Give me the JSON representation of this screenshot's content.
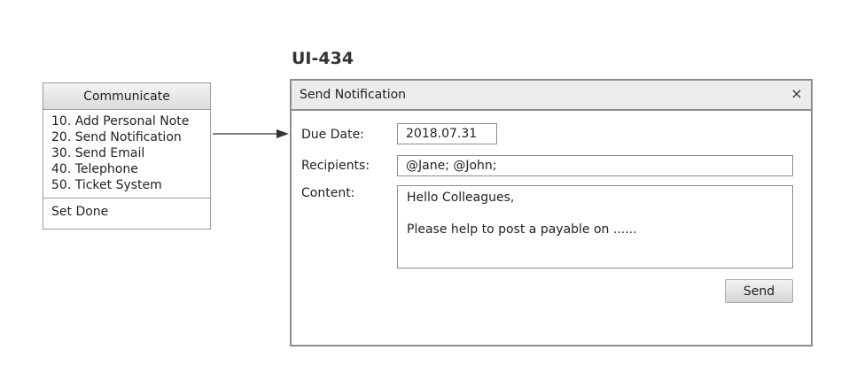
{
  "screen_id": "UI-434",
  "menu": {
    "title": "Communicate",
    "items": [
      "10. Add Personal Note",
      "20. Send Notification",
      "30. Send Email",
      "40. Telephone",
      "50. Ticket System"
    ],
    "footer": "Set Done"
  },
  "dialog": {
    "title": "Send Notification",
    "close_glyph": "×",
    "due_date_label": "Due Date:",
    "due_date_value": "2018.07.31",
    "recipients_label": "Recipients:",
    "recipients_value": "@Jane; @John;",
    "content_label": "Content:",
    "content_lines": [
      "Hello Colleagues,",
      "Please help to post a payable on ......"
    ],
    "send_label": "Send"
  }
}
